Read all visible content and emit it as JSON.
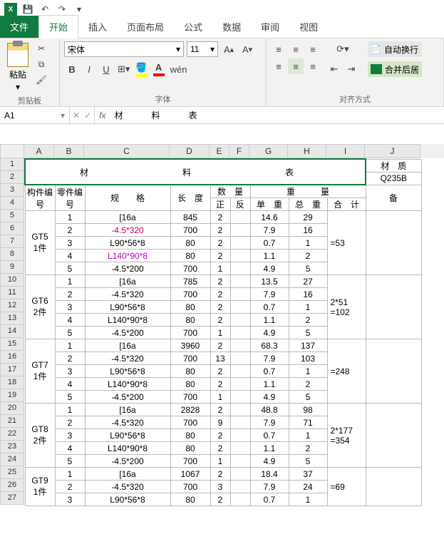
{
  "qat": {
    "save": "💾",
    "undo": "↶",
    "redo": "↷"
  },
  "tabs": {
    "file": "文件",
    "home": "开始",
    "insert": "插入",
    "layout": "页面布局",
    "formula": "公式",
    "data": "数据",
    "review": "审阅",
    "view": "视图"
  },
  "ribbon": {
    "clipboard": {
      "paste": "粘贴",
      "label": "剪贴板"
    },
    "font": {
      "name": "宋体",
      "size": "11",
      "label": "字体",
      "bold": "B",
      "italic": "I",
      "underline": "U",
      "ruby": "wén"
    },
    "align": {
      "label": "对齐方式",
      "wrap": "自动换行",
      "merge": "合并后居"
    }
  },
  "namebox": "A1",
  "formula_value": "材料表",
  "cols": {
    "A": 42,
    "B": 42,
    "C": 120,
    "D": 56,
    "E": 28,
    "F": 28,
    "G": 54,
    "H": 54,
    "I": 54,
    "J": 78
  },
  "title": "材　　　料　　　表",
  "right_title": "材　质",
  "q235b": "Q235B",
  "headers": {
    "component": "构件编号",
    "part": "零件编号",
    "spec": "规　　格",
    "length": "长　度",
    "qty": "数　量",
    "qty_pos": "正",
    "qty_neg": "反",
    "weight": "重　　　量",
    "unit": "单　重",
    "total": "总　重",
    "sum": "合　计",
    "note": "备"
  },
  "groups": [
    {
      "id": "GT5",
      "pieces": "1件",
      "sum": "=53",
      "rows": [
        {
          "p": "1",
          "spec": "[16a",
          "len": "845",
          "pos": "2",
          "neg": "",
          "uw": "14.6",
          "tw": "29",
          "cls": ""
        },
        {
          "p": "2",
          "spec": "-4.5*320",
          "len": "700",
          "pos": "2",
          "neg": "",
          "uw": "7.9",
          "tw": "16",
          "cls": "red"
        },
        {
          "p": "3",
          "spec": "L90*56*8",
          "len": "80",
          "pos": "2",
          "neg": "",
          "uw": "0.7",
          "tw": "1",
          "cls": ""
        },
        {
          "p": "4",
          "spec": "L140*90*8",
          "len": "80",
          "pos": "2",
          "neg": "",
          "uw": "1.1",
          "tw": "2",
          "cls": "magenta"
        },
        {
          "p": "5",
          "spec": "-4.5*200",
          "len": "700",
          "pos": "1",
          "neg": "",
          "uw": "4.9",
          "tw": "5",
          "cls": ""
        }
      ]
    },
    {
      "id": "GT6",
      "pieces": "2件",
      "sum": "2*51\n=102",
      "rows": [
        {
          "p": "1",
          "spec": "[16a",
          "len": "785",
          "pos": "2",
          "neg": "",
          "uw": "13.5",
          "tw": "27",
          "cls": ""
        },
        {
          "p": "2",
          "spec": "-4.5*320",
          "len": "700",
          "pos": "2",
          "neg": "",
          "uw": "7.9",
          "tw": "16",
          "cls": ""
        },
        {
          "p": "3",
          "spec": "L90*56*8",
          "len": "80",
          "pos": "2",
          "neg": "",
          "uw": "0.7",
          "tw": "1",
          "cls": ""
        },
        {
          "p": "4",
          "spec": "L140*90*8",
          "len": "80",
          "pos": "2",
          "neg": "",
          "uw": "1.1",
          "tw": "2",
          "cls": ""
        },
        {
          "p": "5",
          "spec": "-4.5*200",
          "len": "700",
          "pos": "1",
          "neg": "",
          "uw": "4.9",
          "tw": "5",
          "cls": ""
        }
      ]
    },
    {
      "id": "GT7",
      "pieces": "1件",
      "sum": "=248",
      "rows": [
        {
          "p": "1",
          "spec": "[16a",
          "len": "3960",
          "pos": "2",
          "neg": "",
          "uw": "68.3",
          "tw": "137",
          "cls": ""
        },
        {
          "p": "2",
          "spec": "-4.5*320",
          "len": "700",
          "pos": "13",
          "neg": "",
          "uw": "7.9",
          "tw": "103",
          "cls": ""
        },
        {
          "p": "3",
          "spec": "L90*56*8",
          "len": "80",
          "pos": "2",
          "neg": "",
          "uw": "0.7",
          "tw": "1",
          "cls": ""
        },
        {
          "p": "4",
          "spec": "L140*90*8",
          "len": "80",
          "pos": "2",
          "neg": "",
          "uw": "1.1",
          "tw": "2",
          "cls": ""
        },
        {
          "p": "5",
          "spec": "-4.5*200",
          "len": "700",
          "pos": "1",
          "neg": "",
          "uw": "4.9",
          "tw": "5",
          "cls": ""
        }
      ]
    },
    {
      "id": "GT8",
      "pieces": "2件",
      "sum": "2*177\n=354",
      "rows": [
        {
          "p": "1",
          "spec": "[16a",
          "len": "2828",
          "pos": "2",
          "neg": "",
          "uw": "48.8",
          "tw": "98",
          "cls": ""
        },
        {
          "p": "2",
          "spec": "-4.5*320",
          "len": "700",
          "pos": "9",
          "neg": "",
          "uw": "7.9",
          "tw": "71",
          "cls": ""
        },
        {
          "p": "3",
          "spec": "L90*56*8",
          "len": "80",
          "pos": "2",
          "neg": "",
          "uw": "0.7",
          "tw": "1",
          "cls": ""
        },
        {
          "p": "4",
          "spec": "L140*90*8",
          "len": "80",
          "pos": "2",
          "neg": "",
          "uw": "1.1",
          "tw": "2",
          "cls": ""
        },
        {
          "p": "5",
          "spec": "-4.5*200",
          "len": "700",
          "pos": "1",
          "neg": "",
          "uw": "4.9",
          "tw": "5",
          "cls": ""
        }
      ]
    },
    {
      "id": "GT9",
      "pieces": "1件",
      "sum": "=69",
      "rows": [
        {
          "p": "1",
          "spec": "[16a",
          "len": "1067",
          "pos": "2",
          "neg": "",
          "uw": "18.4",
          "tw": "37",
          "cls": ""
        },
        {
          "p": "2",
          "spec": "-4.5*320",
          "len": "700",
          "pos": "3",
          "neg": "",
          "uw": "7.9",
          "tw": "24",
          "cls": ""
        },
        {
          "p": "3",
          "spec": "L90*56*8",
          "len": "80",
          "pos": "2",
          "neg": "",
          "uw": "0.7",
          "tw": "1",
          "cls": ""
        }
      ]
    }
  ]
}
